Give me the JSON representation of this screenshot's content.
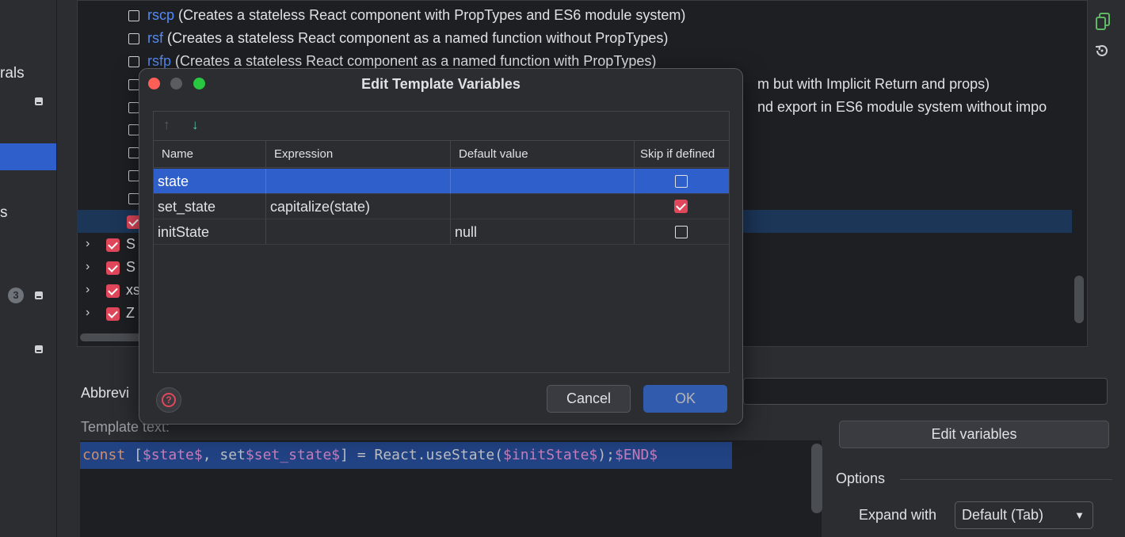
{
  "sidebar": {
    "items": [
      {
        "label": "rals"
      },
      {
        "label": "s"
      }
    ],
    "badge_count": "3"
  },
  "template_list": {
    "rows": [
      {
        "abbr": "rscp",
        "desc": "(Creates a stateless React component with PropTypes and ES6 module system)"
      },
      {
        "abbr": "rsf",
        "desc": "(Creates a stateless React component as a named function without PropTypes)"
      },
      {
        "abbr": "rsfp",
        "desc": "(Creates a stateless React component as a named function with PropTypes)"
      },
      {
        "abbr": "",
        "desc": "m but with Implicit Return and props)"
      },
      {
        "abbr": "",
        "desc": "nd export in ES6 module system without impo"
      }
    ],
    "groups": [
      {
        "label": "S"
      },
      {
        "label": "S"
      },
      {
        "label": "xs"
      },
      {
        "label": "Z"
      }
    ]
  },
  "abbreviation": {
    "label": "Abbrevi"
  },
  "template_text": {
    "label": "Template text:",
    "code": {
      "kw": "const",
      "p1": " [",
      "v1": "$state$",
      "p2": ", set",
      "v2": "$set_state$",
      "p3": "] = React.useState(",
      "v3": "$initState$",
      "p4": ");",
      "v4": "$END$"
    }
  },
  "right_panel": {
    "edit_variables": "Edit variables",
    "options": "Options",
    "expand_with_label": "Expand with",
    "expand_with_value": "Default (Tab)"
  },
  "dialog": {
    "title": "Edit Template Variables",
    "toolbar": {
      "up_icon": "↑",
      "down_icon": "↓"
    },
    "columns": [
      "Name",
      "Expression",
      "Default value",
      "Skip if defined"
    ],
    "rows": [
      {
        "name": "state",
        "expression": "",
        "default": "",
        "skip": false,
        "selected": true
      },
      {
        "name": "set_state",
        "expression": "capitalize(state)",
        "default": "",
        "skip": true,
        "selected": false
      },
      {
        "name": "initState",
        "expression": "",
        "default": "null",
        "skip": false,
        "selected": false
      }
    ],
    "help_icon": "?",
    "cancel": "Cancel",
    "ok": "OK"
  },
  "colors": {
    "accent": "#3574f0",
    "selection": "#2e5fca",
    "checkbox_on": "#e0475a",
    "link": "#548af7"
  }
}
